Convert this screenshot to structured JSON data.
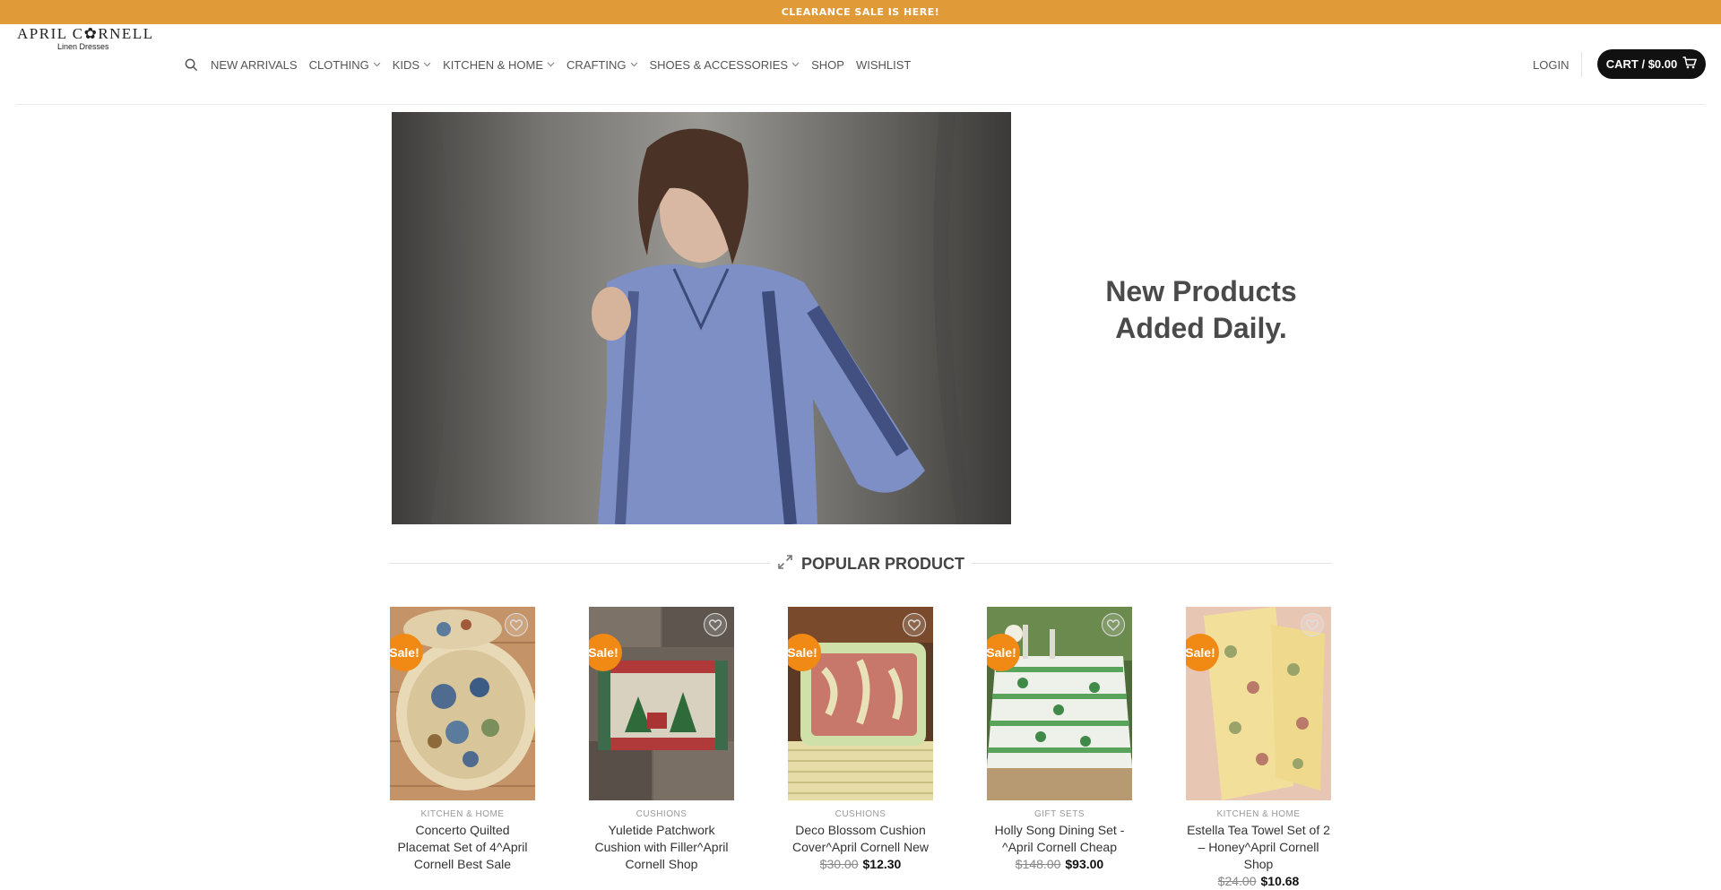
{
  "banner": {
    "text": "CLEARANCE SALE IS HERE!"
  },
  "logo": {
    "main": "APRIL C✿RNELL",
    "sub": "Linen Dresses"
  },
  "nav": {
    "items": [
      {
        "label": "NEW ARRIVALS",
        "dropdown": false
      },
      {
        "label": "CLOTHING",
        "dropdown": true
      },
      {
        "label": "KIDS",
        "dropdown": true
      },
      {
        "label": "KITCHEN & HOME",
        "dropdown": true
      },
      {
        "label": "CRAFTING",
        "dropdown": true
      },
      {
        "label": "SHOES & ACCESSORIES",
        "dropdown": true
      },
      {
        "label": "SHOP",
        "dropdown": false
      },
      {
        "label": "WISHLIST",
        "dropdown": false
      }
    ]
  },
  "account": {
    "login_label": "LOGIN",
    "cart_label": "CART / $0.00"
  },
  "hero": {
    "line1": "New Products",
    "line2": "Added Daily."
  },
  "section": {
    "title": "POPULAR PRODUCT"
  },
  "products": [
    {
      "category": "KITCHEN & HOME",
      "name": "Concerto Quilted Placemat Set of 4^April Cornell Best Sale",
      "old_price": "",
      "price": "",
      "sale": "Sale!"
    },
    {
      "category": "CUSHIONS",
      "name": "Yuletide Patchwork Cushion with Filler^April Cornell Shop",
      "old_price": "",
      "price": "",
      "sale": "Sale!"
    },
    {
      "category": "CUSHIONS",
      "name": "Deco Blossom Cushion Cover^April Cornell New",
      "old_price": "$30.00",
      "price": "$12.30",
      "sale": "Sale!"
    },
    {
      "category": "GIFT SETS",
      "name": "Holly Song Dining Set -^April Cornell Cheap",
      "old_price": "$148.00",
      "price": "$93.00",
      "sale": "Sale!"
    },
    {
      "category": "KITCHEN & HOME",
      "name": "Estella Tea Towel Set of 2 – Honey^April Cornell Shop",
      "old_price": "$24.00",
      "price": "$10.68",
      "sale": "Sale!"
    }
  ],
  "colors": {
    "banner": "#e09a37",
    "sale_badge": "#f08a14",
    "cart_bg": "#111111"
  }
}
